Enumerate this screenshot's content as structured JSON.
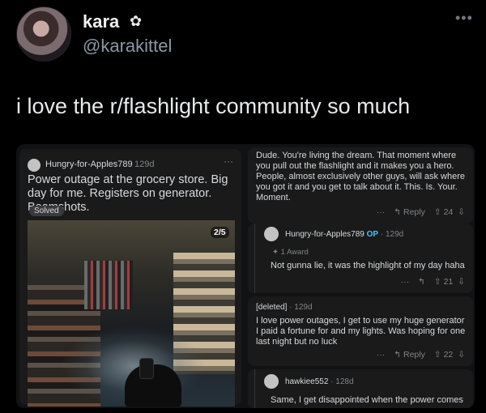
{
  "tweet": {
    "author": {
      "name": "kara",
      "handle": "@karakittel",
      "badge_icon": "flower-icon"
    },
    "more_icon": "ellipsis-icon",
    "text": "i love the r/flashlight community so much"
  },
  "reddit_post": {
    "user": "Hungry-for-Apples789",
    "age": "129d",
    "title": "Power outage at the grocery store. Big day for me. Registers on generator. Beamshots.",
    "flair": "Solved",
    "image_counter": "2/5"
  },
  "comments": [
    {
      "text": "Dude. You're living the dream.  That moment where you pull out the flashlight and it makes you a hero. People, almost exclusively other guys, will ask where you got it and you get to talk about it.  This. Is. Your. Moment.",
      "reply_label": "Reply",
      "votes": "24"
    },
    {
      "user": "Hungry-for-Apples789",
      "op_tag": "OP",
      "age": "129d",
      "award": "1 Award",
      "text": "Not gunna lie, it was the highlight of my day haha",
      "votes": "21"
    },
    {
      "user": "[deleted]",
      "age": "129d",
      "text": "I love power outages, I get to use my huge generator I paid a fortune for and my lights. Was hoping for one last night but no luck",
      "reply_label": "Reply",
      "votes": "22"
    },
    {
      "user": "hawkiee552",
      "age": "128d",
      "text": "Same, I get disappointed when the power comes"
    }
  ]
}
